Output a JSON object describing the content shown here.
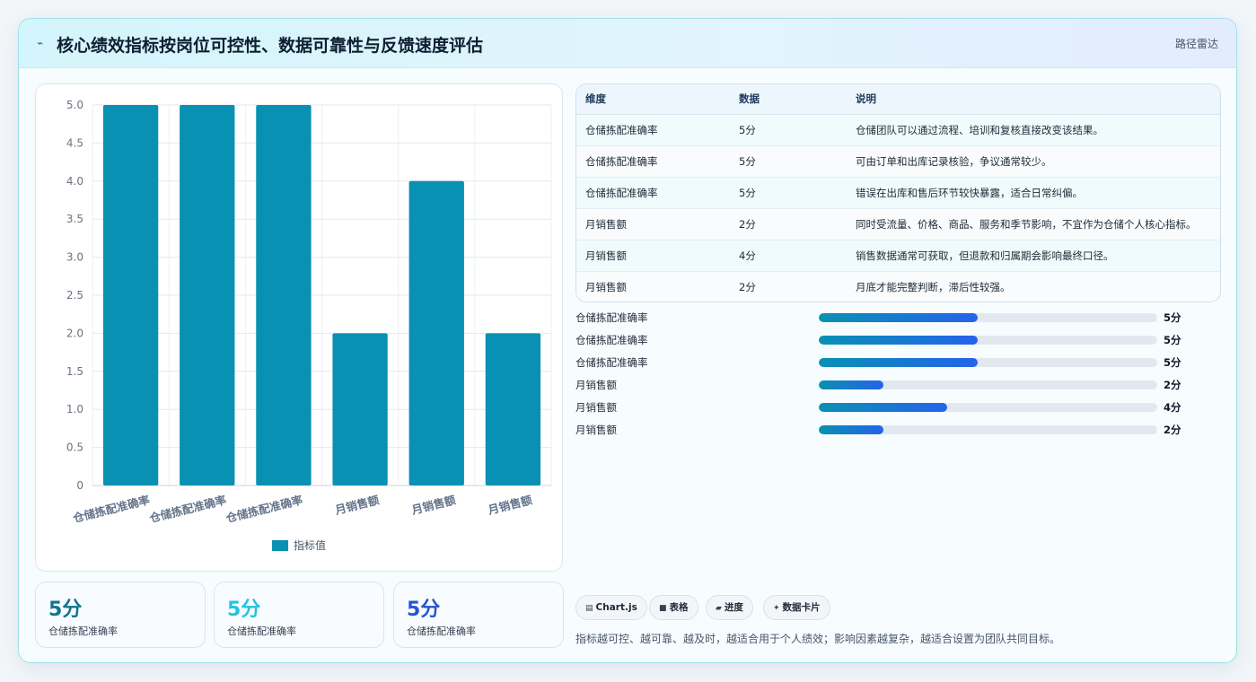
{
  "header": {
    "icon": "trend-icon",
    "title": "核心绩效指标按岗位可控性、数据可靠性与反馈速度评估",
    "tag": "路径雷达"
  },
  "chart_data": {
    "type": "bar",
    "categories": [
      "仓储拣配准确率",
      "仓储拣配准确率",
      "仓储拣配准确率",
      "月销售额",
      "月销售额",
      "月销售额"
    ],
    "series": [
      {
        "name": "指标值",
        "values": [
          5,
          5,
          5,
          2,
          4,
          2
        ],
        "color": "#0891b2"
      }
    ],
    "yticks": [
      "0",
      "0.5",
      "1.0",
      "1.5",
      "2.0",
      "2.5",
      "3.0",
      "3.5",
      "4.0",
      "4.5",
      "5.0"
    ],
    "ylim": [
      0,
      5
    ],
    "grid": true,
    "legend": "bottom"
  },
  "kpis": [
    {
      "value": "5分",
      "label": "仓储拣配准确率",
      "color": "#0e7490"
    },
    {
      "value": "5分",
      "label": "仓储拣配准确率",
      "color": "#22c3e0"
    },
    {
      "value": "5分",
      "label": "仓储拣配准确率",
      "color": "#2554d4"
    }
  ],
  "table": {
    "headers": [
      "维度",
      "数据",
      "说明"
    ],
    "rows": [
      [
        "仓储拣配准确率",
        "5分",
        "仓储团队可以通过流程、培训和复核直接改变该结果。"
      ],
      [
        "仓储拣配准确率",
        "5分",
        "可由订单和出库记录核验，争议通常较少。"
      ],
      [
        "仓储拣配准确率",
        "5分",
        "错误在出库和售后环节较快暴露，适合日常纠偏。"
      ],
      [
        "月销售额",
        "2分",
        "同时受流量、价格、商品、服务和季节影响，不宜作为仓储个人核心指标。"
      ],
      [
        "月销售额",
        "4分",
        "销售数据通常可获取，但退款和归属期会影响最终口径。"
      ],
      [
        "月销售额",
        "2分",
        "月底才能完整判断，滞后性较强。"
      ]
    ]
  },
  "progress": [
    {
      "label": "仓储拣配准确率",
      "value": "5分",
      "fraction": 0.47
    },
    {
      "label": "仓储拣配准确率",
      "value": "5分",
      "fraction": 0.47
    },
    {
      "label": "仓储拣配准确率",
      "value": "5分",
      "fraction": 0.47
    },
    {
      "label": "月销售额",
      "value": "2分",
      "fraction": 0.19
    },
    {
      "label": "月销售额",
      "value": "4分",
      "fraction": 0.38
    },
    {
      "label": "月销售额",
      "value": "2分",
      "fraction": 0.19
    }
  ],
  "chips": [
    {
      "icon": "chart-icon",
      "glyph": "▤",
      "label": "Chart.js"
    },
    {
      "icon": "table-icon",
      "glyph": "■",
      "label": "表格"
    },
    {
      "icon": "progress-icon",
      "glyph": "▰",
      "label": "进度"
    },
    {
      "icon": "card-icon",
      "glyph": "✦",
      "label": "数据卡片"
    }
  ],
  "footnote": "指标越可控、越可靠、越及时，越适合用于个人绩效；影响因素越复杂，越适合设置为团队共同目标。"
}
